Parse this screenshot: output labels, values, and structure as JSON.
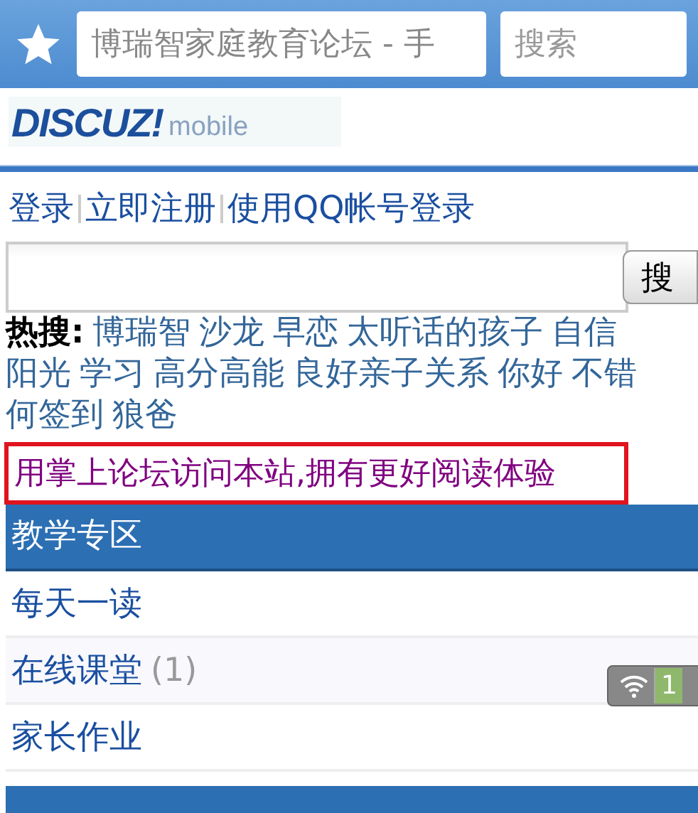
{
  "top_bar": {
    "address": "博瑞智家庭教育论坛 - 手",
    "search_placeholder": "搜索"
  },
  "logo": {
    "brand": "DISCUZ!",
    "suffix": "mobile"
  },
  "account_links": [
    "登录",
    "立即注册",
    "使用QQ帐号登录"
  ],
  "search": {
    "button": "搜"
  },
  "hot_search": {
    "label": "热搜:",
    "lines": [
      [
        "博瑞智",
        "沙龙",
        "早恋",
        "太听话的孩子",
        "自信"
      ],
      [
        "阳光",
        "学习",
        "高分高能",
        "良好亲子关系",
        "你好",
        "不错"
      ],
      [
        "何签到",
        "狼爸"
      ]
    ]
  },
  "app_banner": "用掌上论坛访问本站,拥有更好阅读体验",
  "sections": [
    {
      "title": "教学专区",
      "forums": [
        {
          "name": "每天一读"
        },
        {
          "name": "在线课堂",
          "count": "(1)"
        },
        {
          "name": "家长作业"
        }
      ]
    }
  ],
  "more_sections_below": true,
  "status_pill": {
    "text": "1"
  }
}
